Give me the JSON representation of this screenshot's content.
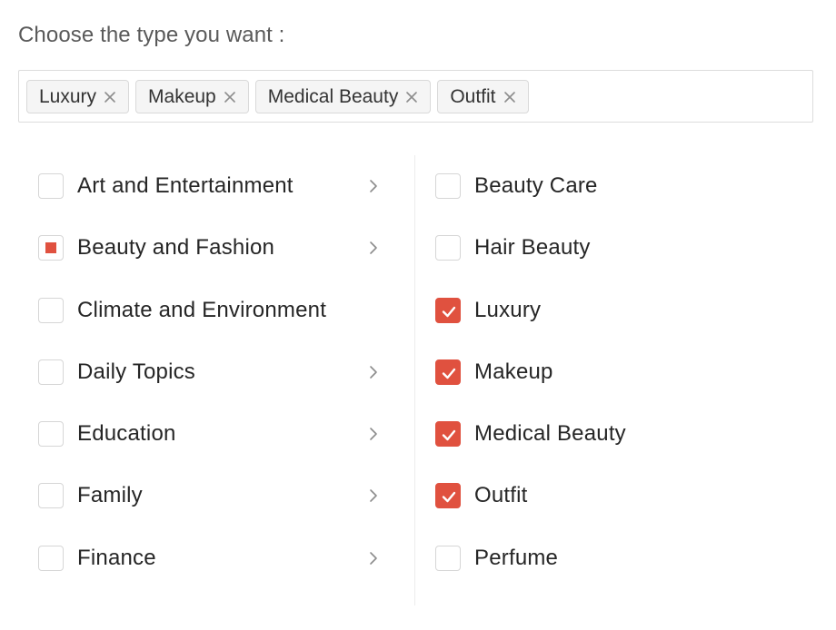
{
  "prompt": "Choose the type you want :",
  "selected_tags": [
    "Luxury",
    "Makeup",
    "Medical Beauty",
    "Outfit"
  ],
  "colors": {
    "accent": "#e0513f",
    "border": "#dcdcdc",
    "text": "#262626"
  },
  "icons": {
    "tag_remove": "close-icon",
    "expand": "chevron-right-icon",
    "checked": "check-icon"
  },
  "categories": [
    {
      "label": "Art and Entertainment",
      "state": "unchecked",
      "has_children": true
    },
    {
      "label": "Beauty and Fashion",
      "state": "indeterminate",
      "has_children": true
    },
    {
      "label": "Climate and Environment",
      "state": "unchecked",
      "has_children": false
    },
    {
      "label": "Daily Topics",
      "state": "unchecked",
      "has_children": true
    },
    {
      "label": "Education",
      "state": "unchecked",
      "has_children": true
    },
    {
      "label": "Family",
      "state": "unchecked",
      "has_children": true
    },
    {
      "label": "Finance",
      "state": "unchecked",
      "has_children": true
    }
  ],
  "subcategories": [
    {
      "label": "Beauty Care",
      "state": "unchecked"
    },
    {
      "label": "Hair Beauty",
      "state": "unchecked"
    },
    {
      "label": "Luxury",
      "state": "checked"
    },
    {
      "label": "Makeup",
      "state": "checked"
    },
    {
      "label": "Medical Beauty",
      "state": "checked"
    },
    {
      "label": "Outfit",
      "state": "checked"
    },
    {
      "label": "Perfume",
      "state": "unchecked"
    }
  ]
}
